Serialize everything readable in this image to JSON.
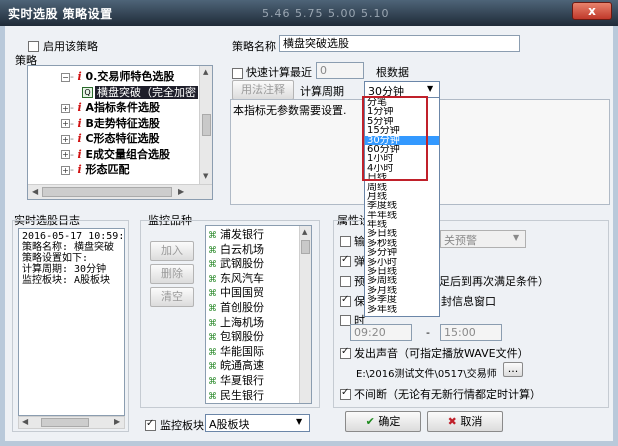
{
  "window": {
    "title": "实时选股 策略设置",
    "bg_strip": "5.46  5.75  5.00  5.10",
    "close": "x"
  },
  "strategy": {
    "enable_label": "启用该策略",
    "section_label": "策略",
    "name_label": "策略名称",
    "name_value": "横盘突破选股"
  },
  "tree": [
    {
      "label": "0.交易师特色选股",
      "bold": true,
      "red": true
    },
    {
      "label": "横盘突破（完全加密",
      "selected": true
    },
    {
      "label": "A指标条件选股",
      "bold": true,
      "red": true
    },
    {
      "label": "B走势特征选股",
      "bold": true,
      "red": true
    },
    {
      "label": "C形态特征选股",
      "bold": true,
      "red": true
    },
    {
      "label": "E成交量组合选股",
      "bold": true,
      "red": true
    },
    {
      "label": "形态匹配",
      "bold": true,
      "red": true
    }
  ],
  "calc": {
    "quick_label": "快速计算最近",
    "quick_value": "0",
    "basis_label": "根数据",
    "usage_button": "用法注释",
    "period_label": "计算周期",
    "period_value": "30分钟",
    "description": "本指标无参数需要设置."
  },
  "period_options": [
    "分笔",
    "1分钟",
    "5分钟",
    "15分钟",
    "30分钟",
    "60分钟",
    "1小时",
    "4小时",
    "日线",
    "周线",
    "月线",
    "季度线",
    "半年线",
    "年线",
    "多日线",
    "多秒线",
    "多分钟",
    "多小时",
    "多日线",
    "多周线",
    "多月线",
    "多季度",
    "多年线"
  ],
  "log": {
    "title": "实时选股日志",
    "text": "2016-05-17 10:59:5\n策略名称: 横盘突破\n策略设置如下:\n计算周期: 30分钟\n监控板块: A股板块"
  },
  "monitor": {
    "title": "监控品种",
    "add": "加入",
    "delete": "删除",
    "clear": "清空",
    "stocks": [
      "浦发银行",
      "白云机场",
      "武钢股份",
      "东风汽车",
      "中国国贸",
      "首创股份",
      "上海机场",
      "包钢股份",
      "华能国际",
      "皖通高速",
      "华夏银行",
      "民生银行"
    ],
    "board_label": "监控板块",
    "board_value": "A股板块"
  },
  "props": {
    "title": "属性设",
    "input_label": "输",
    "style_value": "关预警",
    "popup_label": "弹",
    "pre_label": "预",
    "pre_text": "满足后到再次满足条件）",
    "keep_label": "保",
    "keep_text": "封信息窗口",
    "time_label": "时",
    "time_from": "09:20",
    "dash": "-",
    "time_to": "15:00",
    "sound_label": "发出声音（可指定播放WAVE文件）",
    "sound_path": "E:\\2016测试文件\\0517\\交易师",
    "browse": "...",
    "continuous_label": "不间断（无论有无新行情都定时计算）",
    "ok": "确定",
    "cancel": "取消"
  }
}
